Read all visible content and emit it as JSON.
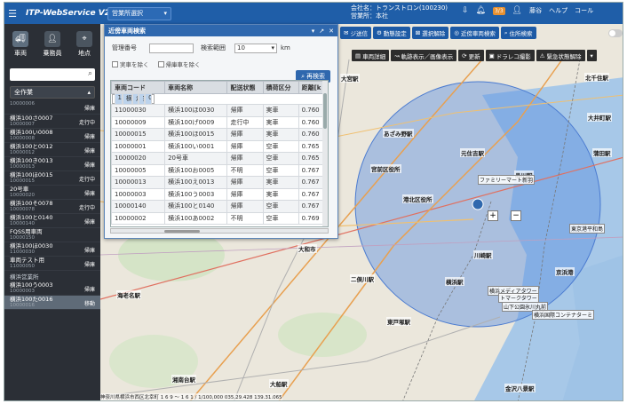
{
  "header": {
    "brand": "ITP-WebService V2",
    "office_select": "営業所選択",
    "company_label": "会社名：トランストロン(100230)",
    "office_label": "営業所：本社",
    "badge": "3/3",
    "user": "藤谷",
    "help": "ヘルプ",
    "call": "コール"
  },
  "sidebar": {
    "tabs": [
      {
        "label": "車両",
        "icon": "truck-icon"
      },
      {
        "label": "乗務員",
        "icon": "person-icon"
      },
      {
        "label": "地点",
        "icon": "location-pin-icon"
      }
    ],
    "filter": "全作業",
    "vehicles": [
      {
        "name": "",
        "code": "10000006",
        "status": "帰庫"
      },
      {
        "name": "横浜100さ0007",
        "code": "10000007",
        "status": "走行中"
      },
      {
        "name": "横浜100い0008",
        "code": "10000008",
        "status": "帰庫"
      },
      {
        "name": "横浜100と0012",
        "code": "10000012",
        "status": "帰庫"
      },
      {
        "name": "横浜100き0013",
        "code": "10000013",
        "status": "帰庫"
      },
      {
        "name": "横浜100ほ0015",
        "code": "10000015",
        "status": "走行中"
      },
      {
        "name": "20号車",
        "code": "10000020",
        "status": "帰庫"
      },
      {
        "name": "横浜100そ0078",
        "code": "10000078",
        "status": "走行中"
      },
      {
        "name": "横浜100と0140",
        "code": "10000140",
        "status": "帰庫"
      },
      {
        "name": "FQSS用車両",
        "code": "10000150",
        "status": ""
      },
      {
        "name": "横浜100ほ0030",
        "code": "11000030",
        "status": "帰庫"
      },
      {
        "name": "車両テスト用",
        "code": "11000050",
        "status": "帰庫"
      }
    ],
    "group": "横浜営業所",
    "vehicles2": [
      {
        "name": "横浜100う0003",
        "code": "10000003",
        "status": "帰庫"
      },
      {
        "name": "横浜100た0016",
        "code": "10000016",
        "status": "移動"
      }
    ]
  },
  "map_toolbar1": [
    {
      "label": "ジ送信",
      "icon": "send-icon"
    },
    {
      "label": "動態設定",
      "icon": "gear-icon"
    },
    {
      "label": "選択解除",
      "icon": "clear-icon"
    },
    {
      "label": "近傍車両検索",
      "icon": "nearby-search-icon"
    },
    {
      "label": "住所検索",
      "icon": "search-icon"
    }
  ],
  "map_toolbar2": [
    {
      "label": "車両詳細",
      "icon": "detail-icon"
    },
    {
      "label": "軌跡表示／画像表示",
      "icon": "track-icon"
    },
    {
      "label": "更新",
      "icon": "refresh-icon"
    },
    {
      "label": "ドラレコ撮影",
      "icon": "camera-icon"
    },
    {
      "label": "緊急状態解除",
      "icon": "alert-icon"
    }
  ],
  "map_labels": [
    {
      "text": "北千住駅"
    },
    {
      "text": "大井町駅"
    },
    {
      "text": "あざみ野駅"
    },
    {
      "text": "市が尾駅"
    },
    {
      "text": "青葉区役所"
    },
    {
      "text": "宮前区役所"
    },
    {
      "text": "元住吉駅"
    },
    {
      "text": "品川駅"
    },
    {
      "text": "蒲田駅"
    },
    {
      "text": "川崎駅"
    },
    {
      "text": "横浜駅"
    },
    {
      "text": "大和市"
    },
    {
      "text": "二俣川駅"
    },
    {
      "text": "海老名駅"
    },
    {
      "text": "戸塚駅"
    },
    {
      "text": "東戸塚駅"
    },
    {
      "text": "大船駅"
    },
    {
      "text": "藤沢駅"
    },
    {
      "text": "湘南台駅"
    },
    {
      "text": "金沢八景駅"
    },
    {
      "text": "横須賀中央駅"
    },
    {
      "text": "京浜港"
    },
    {
      "text": "港北区役所"
    },
    {
      "text": "町田駅"
    },
    {
      "text": "大宮駅"
    }
  ],
  "pois": [
    {
      "text": "ファミリーマート新羽"
    },
    {
      "text": "横浜メディアタワー"
    },
    {
      "text": "トマークタワー"
    },
    {
      "text": "山下公園氷川丸前"
    },
    {
      "text": "東京港平和島"
    },
    {
      "text": "横浜国際コンテナターミ"
    }
  ],
  "map_footer": "神奈川県横浜市西区北幸町 1 6 9 ～ 1 6 1 / 1/100,000 035.29.428 139.31.065",
  "dialog": {
    "title": "近傍車両検索",
    "mgmt_label": "管理番号",
    "mgmt_value": "",
    "range_label": "検索範囲",
    "range_value": "10",
    "range_unit": "km",
    "cb1": "実車を除く",
    "cb2": "帰庫車を除く",
    "search_btn": "再検索",
    "columns": [
      "車両コード",
      "車両名称",
      "配送状態",
      "積荷区分",
      "距離[k"
    ],
    "rows": [
      [
        "10000078",
        "横浜100そ0078",
        "走行中",
        "実車",
        "0.731"
      ],
      [
        "11000030",
        "横浜100ほ0030",
        "帰庫",
        "実車",
        "0.760"
      ],
      [
        "10000009",
        "横浜100げ0009",
        "走行中",
        "実車",
        "0.760"
      ],
      [
        "10000015",
        "横浜100ほ0015",
        "帰庫",
        "実車",
        "0.760"
      ],
      [
        "10000001",
        "横浜100い0001",
        "帰庫",
        "空車",
        "0.765"
      ],
      [
        "10000020",
        "20号車",
        "帰庫",
        "空車",
        "0.765"
      ],
      [
        "10000005",
        "横浜100お0005",
        "不明",
        "空車",
        "0.767"
      ],
      [
        "10000013",
        "横浜100え0013",
        "帰庫",
        "実車",
        "0.767"
      ],
      [
        "10000003",
        "横浜100う0003",
        "帰庫",
        "実車",
        "0.767"
      ],
      [
        "10000140",
        "横浜100と0140",
        "帰庫",
        "空車",
        "0.767"
      ],
      [
        "10000002",
        "横浜100あ0002",
        "不明",
        "空車",
        "0.769"
      ]
    ]
  }
}
